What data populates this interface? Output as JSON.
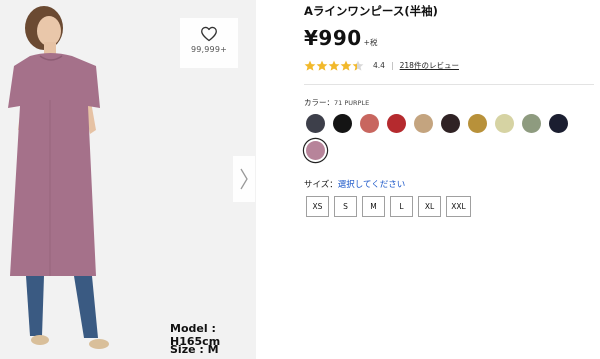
{
  "gallery": {
    "fav_count": "99,999+",
    "model_height": "Model : H165cm",
    "model_size": "Size : M"
  },
  "product": {
    "title": "Aラインワンピース(半袖)",
    "price": "¥990",
    "tax_note": "+税",
    "rating": 4.4,
    "rating_text": "4.4",
    "rating_separator": "|",
    "reviews_link": "218件のレビュー"
  },
  "color": {
    "label": "カラー：",
    "selected_name": "71 PURPLE",
    "swatches": [
      {
        "hex": "#3d3f4a",
        "selected": false
      },
      {
        "hex": "#141414",
        "selected": false
      },
      {
        "hex": "#c8665f",
        "selected": false
      },
      {
        "hex": "#b52a2e",
        "selected": false
      },
      {
        "hex": "#c4a47f",
        "selected": false
      },
      {
        "hex": "#2f2224",
        "selected": false
      },
      {
        "hex": "#b8913a",
        "selected": false
      },
      {
        "hex": "#d6d3a3",
        "selected": false
      },
      {
        "hex": "#8e9b7f",
        "selected": false
      },
      {
        "hex": "#1b1e30",
        "selected": false
      },
      {
        "hex": "#b7849a",
        "selected": true
      }
    ]
  },
  "size": {
    "label": "サイズ：",
    "prompt": "選択してください",
    "options": [
      "XS",
      "S",
      "M",
      "L",
      "XL",
      "XXL"
    ]
  },
  "colors": {
    "star_fill": "#f2b92b",
    "star_empty": "#d8d8d8",
    "link_blue": "#1a56c8"
  }
}
